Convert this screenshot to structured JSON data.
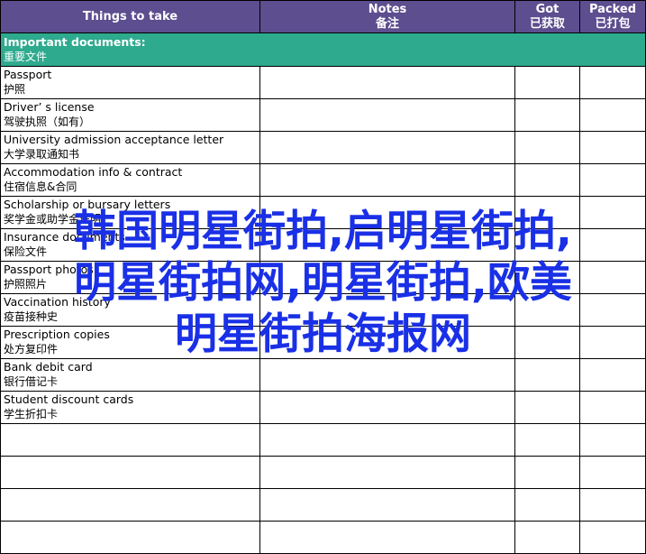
{
  "header": {
    "col1": {
      "en": "Things to take"
    },
    "col2": {
      "en": "Notes",
      "zh": "备注"
    },
    "col3": {
      "en": "Got",
      "zh": "已获取"
    },
    "col4": {
      "en": "Packed",
      "zh": "已打包"
    }
  },
  "section": {
    "en": "Important documents:",
    "zh": "重要文件"
  },
  "items": [
    {
      "en": "Passport",
      "zh": "护照"
    },
    {
      "en": "Driver’ s license",
      "zh": "驾驶执照（如有）"
    },
    {
      "en": "University admission acceptance letter",
      "zh": "大学录取通知书"
    },
    {
      "en": "Accommodation info & contract",
      "zh": "住宿信息&合同"
    },
    {
      "en": "Scholarship or bursary letters",
      "zh": "奖学金或助学金证明"
    },
    {
      "en": "Insurance documents",
      "zh": "保险文件"
    },
    {
      "en": "Passport photos",
      "zh": "护照照片"
    },
    {
      "en": "Vaccination history",
      "zh": "疫苗接种史"
    },
    {
      "en": "Prescription copies",
      "zh": "处方复印件"
    },
    {
      "en": "Bank debit card",
      "zh": "银行借记卡"
    },
    {
      "en": "Student discount cards",
      "zh": "学生折扣卡"
    }
  ],
  "watermark": {
    "line1": "韩国明星街拍,启明星街拍,",
    "line2": "明星街拍网,明星街拍,欧美",
    "line3": "明星街拍海报网",
    "color": "#1a30e6"
  },
  "colors": {
    "header_bg": "#5c4e8f",
    "section_bg": "#2eaa8e"
  }
}
